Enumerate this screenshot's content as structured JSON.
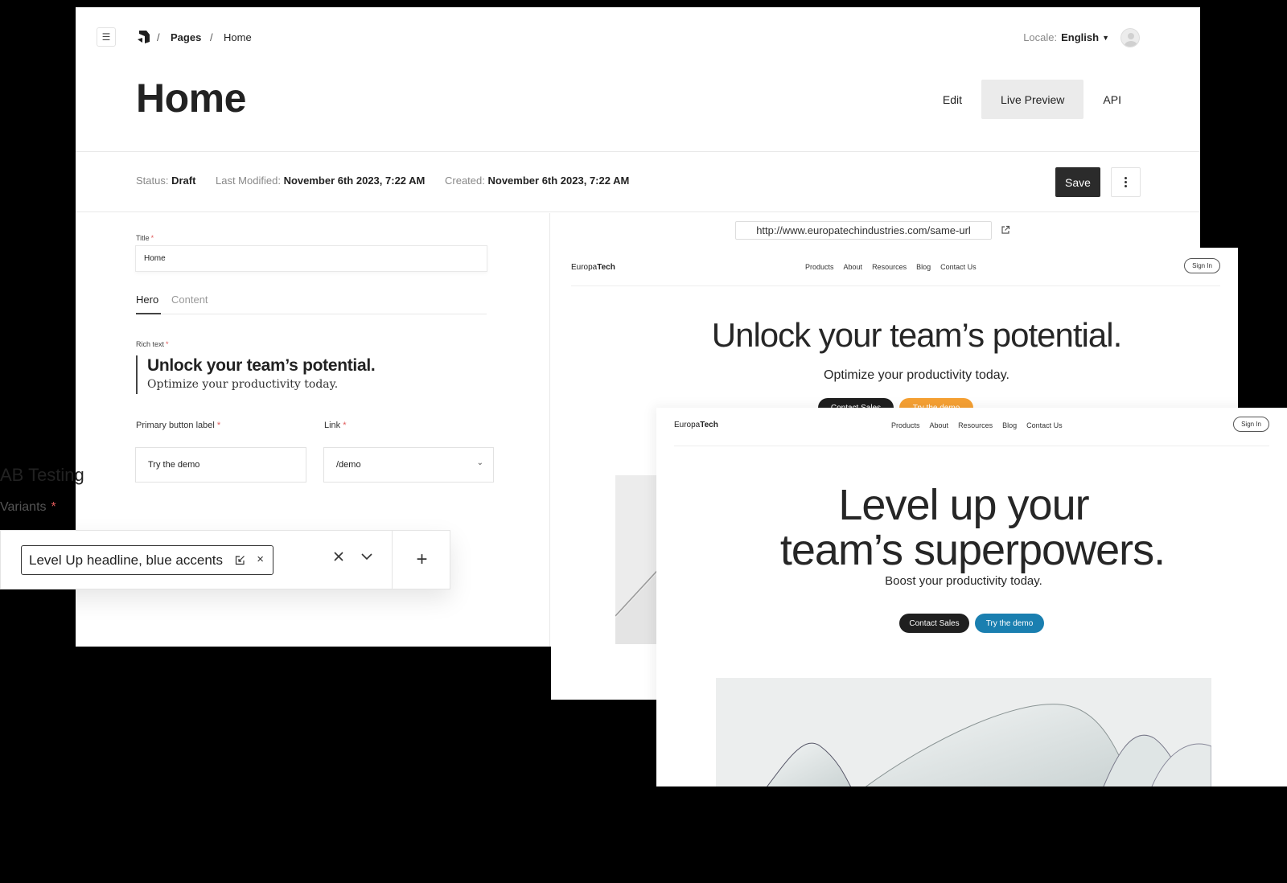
{
  "topbar": {
    "menu_icon": "hamburger-icon",
    "logo_icon": "brand-logo-icon",
    "breadcrumb": [
      {
        "label": "Pages"
      },
      {
        "label": "Home"
      }
    ],
    "breadcrumb_separator": "/",
    "locale_label": "Locale:",
    "locale_value": "English",
    "avatar_icon": "user-avatar-icon"
  },
  "header": {
    "title": "Home",
    "view_tabs": [
      {
        "label": "Edit",
        "active": false
      },
      {
        "label": "Live Preview",
        "active": true
      },
      {
        "label": "API",
        "active": false
      }
    ]
  },
  "status_bar": {
    "status_label": "Status:",
    "status_value": "Draft",
    "modified_label": "Last Modified:",
    "modified_value": "November 6th 2023, 7:22 AM",
    "created_label": "Created:",
    "created_value": "November 6th 2023, 7:22 AM",
    "save_label": "Save",
    "more_icon": "kebab-menu-icon"
  },
  "editor": {
    "title_label": "Title",
    "title_value": "Home",
    "required_mark": "*",
    "tabs": [
      {
        "label": "Hero",
        "active": true
      },
      {
        "label": "Content",
        "active": false
      }
    ],
    "rich_text_label": "Rich text",
    "rich_text_heading": "Unlock your team’s potential.",
    "rich_text_body": "Optimize your productivity today.",
    "primary_button_label": "Primary button label",
    "primary_button_value": "Try the demo",
    "link_label": "Link",
    "link_value": "/demo"
  },
  "ab_testing": {
    "title": "AB Testing",
    "variants_label": "Variants",
    "selected_variant": "Level Up headline, blue accents",
    "add_label": "+"
  },
  "preview": {
    "url": "http://www.europatechindustries.com/same-url",
    "brand_prefix": "Europa",
    "brand_suffix": "Tech",
    "nav_links": [
      "Products",
      "About",
      "Resources",
      "Blog",
      "Contact Us"
    ],
    "signin_label": "Sign In",
    "variant_a": {
      "headline": "Unlock your team’s potential.",
      "subheadline": "Optimize your productivity today.",
      "secondary_button": "Contact Sales",
      "primary_button": "Try the demo",
      "accent_color": "#f5a033"
    },
    "variant_b": {
      "headline_line1": "Level up your",
      "headline_line2": "team’s superpowers.",
      "subheadline": "Boost your productivity today.",
      "secondary_button": "Contact Sales",
      "primary_button": "Try the demo",
      "accent_color": "#1a7fb0"
    }
  }
}
